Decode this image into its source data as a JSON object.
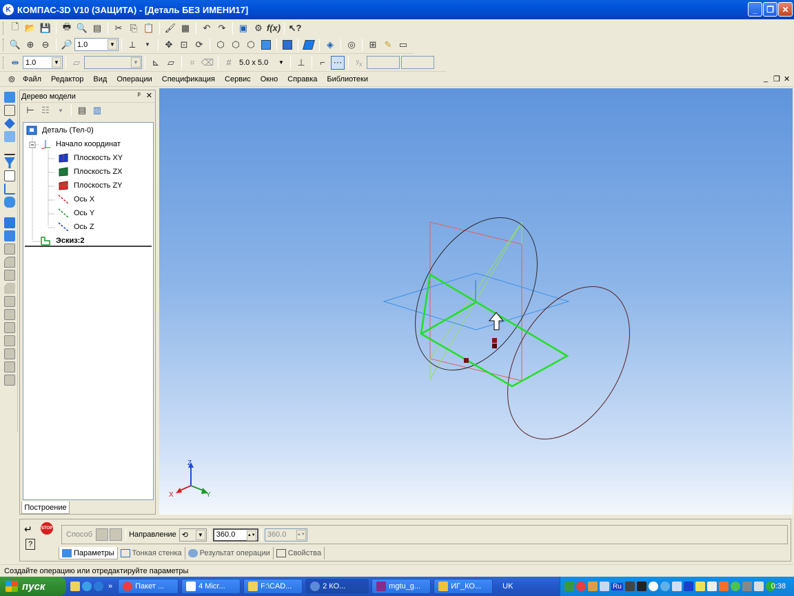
{
  "window": {
    "title": "КОМПАС-3D V10 (ЗАЩИТА) - [Деталь БЕЗ ИМЕНИ17]",
    "minimize": "_",
    "restore": "❐",
    "close": "✕"
  },
  "toolbar2": {
    "zoom_value": "1.0"
  },
  "toolbar3": {
    "step_value": "1.0",
    "grid_value": "5.0 x 5.0"
  },
  "menu": {
    "items": [
      "Файл",
      "Редактор",
      "Вид",
      "Операции",
      "Спецификация",
      "Сервис",
      "Окно",
      "Справка",
      "Библиотеки"
    ],
    "doc_controls": [
      "_",
      "❐",
      "✕"
    ]
  },
  "tree": {
    "header": "Дерево модели",
    "pin": "ᵖ",
    "close": "✕",
    "nodes": [
      {
        "label": "Деталь (Тел-0)"
      },
      {
        "label": "Начало координат"
      },
      {
        "label": "Плоскость XY"
      },
      {
        "label": "Плоскость ZX"
      },
      {
        "label": "Плоскость ZY"
      },
      {
        "label": "Ось X"
      },
      {
        "label": "Ось Y"
      },
      {
        "label": "Ось Z"
      },
      {
        "label": "Эскиз:2"
      }
    ],
    "tab": "Построение"
  },
  "viewport": {
    "axes": {
      "x": "X",
      "y": "Y",
      "z": "Z"
    }
  },
  "props": {
    "method_label": "Способ",
    "direction_label": "Направление",
    "angle1": "360.0",
    "angle2": "360.0",
    "tabs": [
      "Параметры",
      "Тонкая стенка",
      "Результат операции",
      "Свойства"
    ]
  },
  "status": "Создайте операцию или отредактируйте параметры",
  "taskbar": {
    "start": "пуск",
    "buttons": [
      "Пакет ...",
      "4 Micr...",
      "F:\\CAD...",
      "2 КО...",
      "mgtu_g...",
      "ИГ_КО..."
    ],
    "lang": "UK",
    "tray_lang": "Ru",
    "clock": "0:38"
  }
}
